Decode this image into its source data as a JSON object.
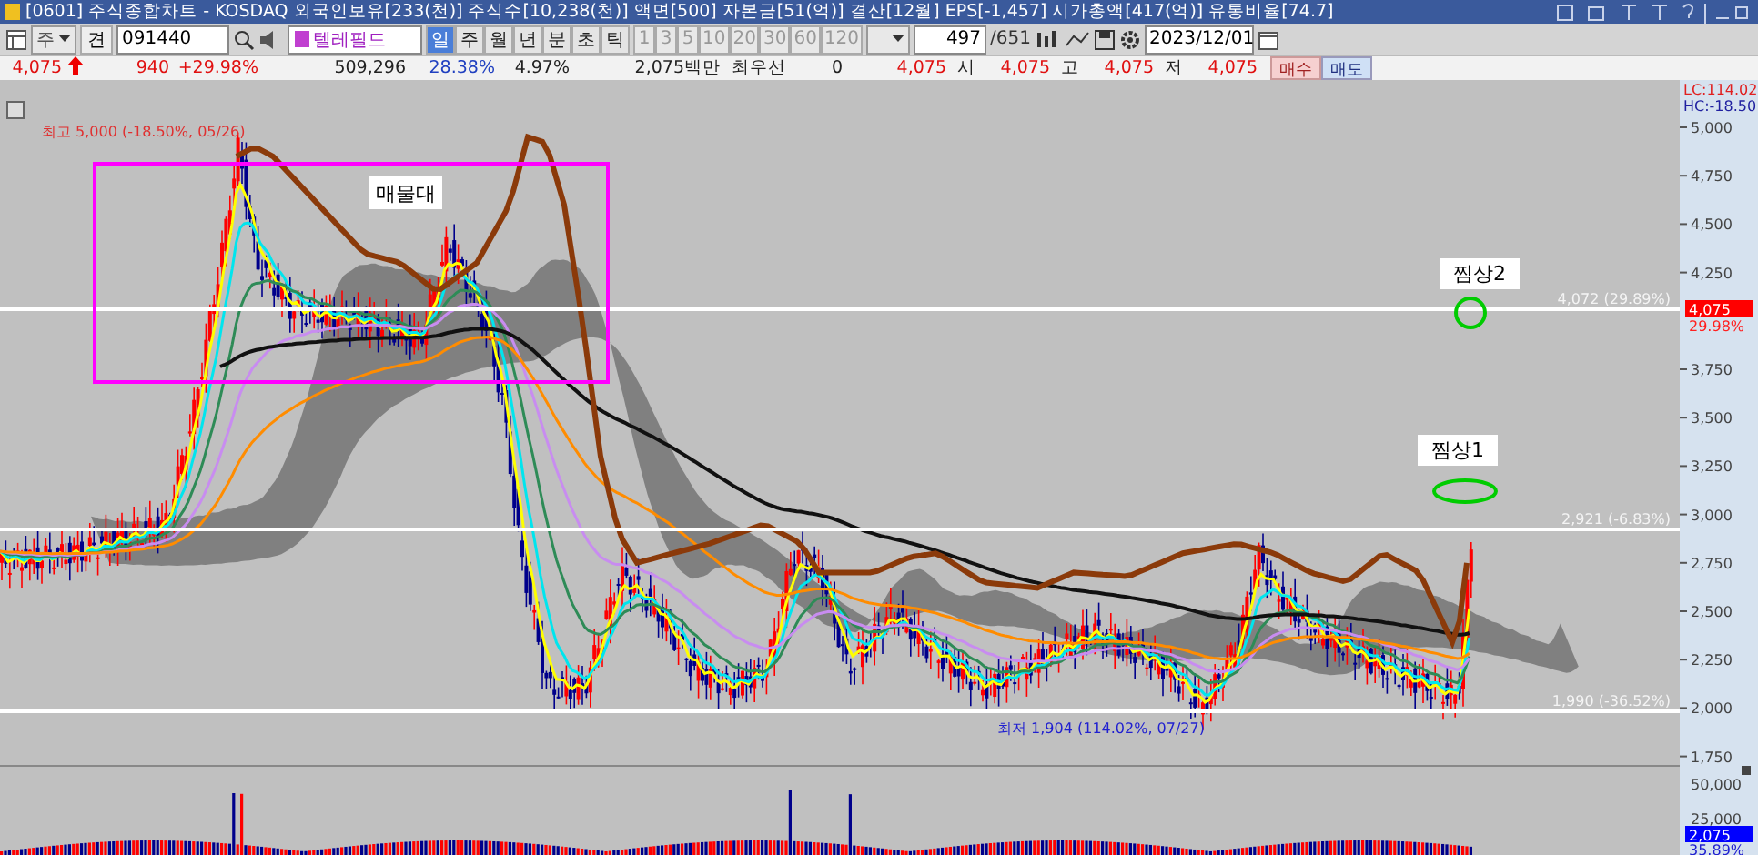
{
  "window": {
    "title": "[0601] 주식종합차트 - KOSDAQ 외국인보유[233(천)] 주식수[10,238(천)] 액면[500] 자본금[51(억)] 결산[12월] EPS[-1,457] 시가총액[417(억)] 유통비율[74.7]"
  },
  "toolbar": {
    "market": "주",
    "mode": "견",
    "code": "091440",
    "stock_name": "텔레필드",
    "periods": [
      {
        "label": "일",
        "selected": true
      },
      {
        "label": "주",
        "selected": false
      },
      {
        "label": "월",
        "selected": false
      },
      {
        "label": "년",
        "selected": false
      },
      {
        "label": "분",
        "selected": false
      },
      {
        "label": "초",
        "selected": false
      },
      {
        "label": "틱",
        "selected": false
      }
    ],
    "intervals": [
      {
        "label": "1",
        "disabled": true
      },
      {
        "label": "3",
        "disabled": true
      },
      {
        "label": "5",
        "disabled": true
      },
      {
        "label": "10",
        "disabled": true
      },
      {
        "label": "20",
        "disabled": true
      },
      {
        "label": "30",
        "disabled": true
      },
      {
        "label": "60",
        "disabled": true
      },
      {
        "label": "120",
        "disabled": true
      }
    ],
    "count": "497",
    "total": "/651",
    "date": "2023/12/01"
  },
  "quote": {
    "price": "4,075",
    "change": "940",
    "change_rate": "+29.98%",
    "volume": "509,296",
    "turnover": "28.38%",
    "ratio": "4.97%",
    "amount": "2,075백만",
    "best_label": "최우선",
    "best_qty": "0",
    "best_price": "4,075",
    "open_label": "시",
    "open": "4,075",
    "high_label": "고",
    "high": "4,075",
    "low_label": "저",
    "low": "4,075",
    "buy": "매수",
    "sell": "매도"
  },
  "chart": {
    "high_marker": "최고 5,000 (-18.50%, 05/26)",
    "low_marker": "최저 1,904 (114.02%, 07/27)",
    "box_label": "매물대",
    "notes": [
      {
        "text": "찜상2"
      },
      {
        "text": "찜상1"
      }
    ],
    "levels": [
      {
        "label": "4,072 (29.89%)"
      },
      {
        "label": "2,921 (-6.83%)"
      },
      {
        "label": "1,990 (-36.52%)"
      }
    ]
  },
  "axis": {
    "lc": "LC:114.02",
    "hc": "HC:-18.50",
    "price_ticks": [
      "5,000",
      "4,750",
      "4,500",
      "4,250",
      "3,750",
      "3,500",
      "3,250",
      "3,000",
      "2,750",
      "2,500",
      "2,250",
      "2,000",
      "1,750"
    ],
    "price_tag": "4,075",
    "price_tag_rate": "29.98%",
    "volume_ticks": [
      "50,000",
      "25,000"
    ],
    "volume_tag": "2,075",
    "volume_tag_rate": "35.89%"
  }
}
